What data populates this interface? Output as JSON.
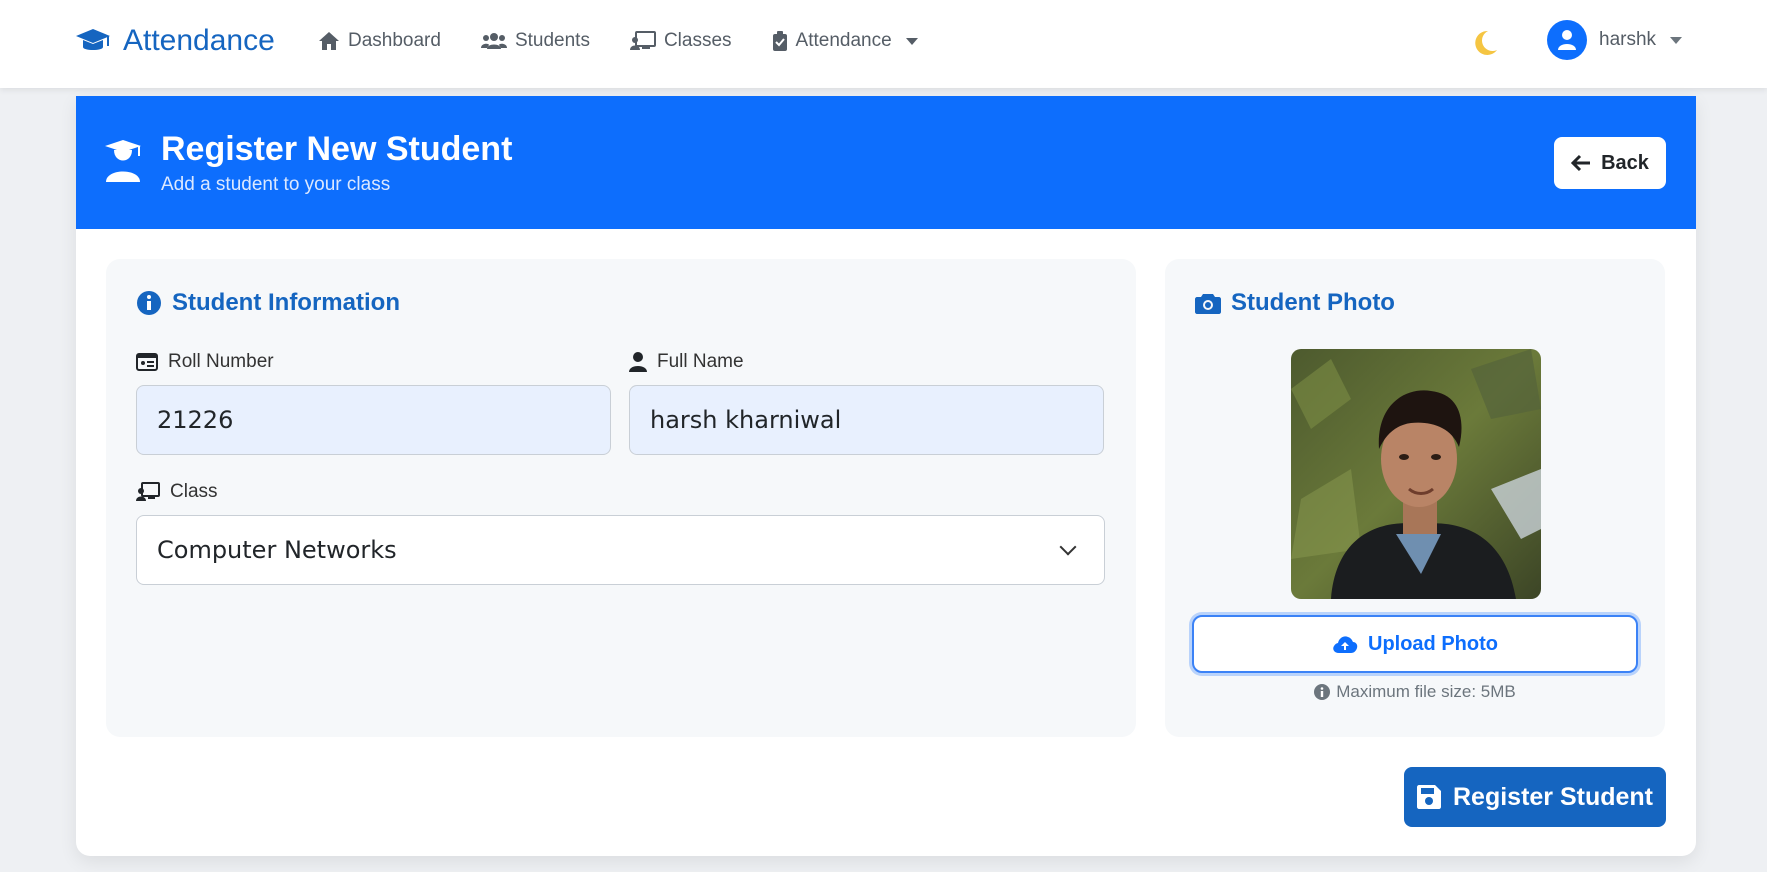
{
  "navbar": {
    "brand": "Attendance",
    "links": [
      {
        "label": "Dashboard",
        "icon": "home-icon"
      },
      {
        "label": "Students",
        "icon": "users-icon"
      },
      {
        "label": "Classes",
        "icon": "chalkboard-icon"
      },
      {
        "label": "Attendance",
        "icon": "clipboard-check-icon"
      }
    ],
    "theme_toggle_icon": "moon-icon",
    "username": "harshk"
  },
  "header": {
    "title": "Register New Student",
    "subtitle": "Add a student to your class",
    "back_label": "Back"
  },
  "student_info": {
    "title": "Student Information",
    "roll_label": "Roll Number",
    "roll_value": "21226",
    "name_label": "Full Name",
    "name_value": "harsh kharniwal",
    "class_label": "Class",
    "class_value": "Computer Networks"
  },
  "photo": {
    "title": "Student Photo",
    "upload_label": "Upload Photo",
    "hint": "Maximum file size: 5MB"
  },
  "register_label": "Register Student",
  "colors": {
    "primary": "#0d6efd",
    "primary_dark": "#1565c0",
    "panel_bg": "#f6f8fa",
    "input_bg": "#e8f0fe"
  }
}
